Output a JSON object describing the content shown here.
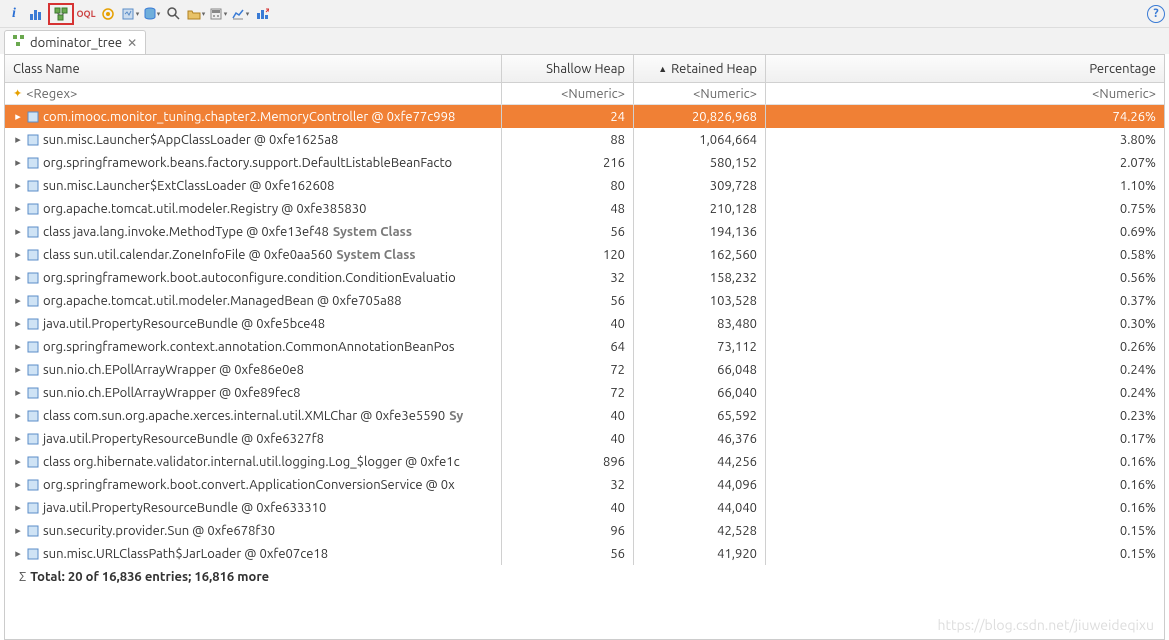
{
  "toolbar": {
    "help_tooltip": "Help"
  },
  "tab": {
    "label": "dominator_tree",
    "icon": "tree-icon"
  },
  "columns": {
    "name": "Class Name",
    "shallow": "Shallow Heap",
    "retained": "Retained Heap",
    "percent": "Percentage"
  },
  "filter": {
    "regex": "<Regex>",
    "numeric": "<Numeric>"
  },
  "rows": [
    {
      "name": "com.imooc.monitor_tuning.chapter2.MemoryController @ 0xfe77c998",
      "suffix": "",
      "shallow": "24",
      "retained": "20,826,968",
      "percent": "74.26%",
      "selected": true
    },
    {
      "name": "sun.misc.Launcher$AppClassLoader @ 0xfe1625a8",
      "suffix": "",
      "shallow": "88",
      "retained": "1,064,664",
      "percent": "3.80%"
    },
    {
      "name": "org.springframework.beans.factory.support.DefaultListableBeanFacto",
      "suffix": "",
      "shallow": "216",
      "retained": "580,152",
      "percent": "2.07%"
    },
    {
      "name": "sun.misc.Launcher$ExtClassLoader @ 0xfe162608",
      "suffix": "",
      "shallow": "80",
      "retained": "309,728",
      "percent": "1.10%"
    },
    {
      "name": "org.apache.tomcat.util.modeler.Registry @ 0xfe385830",
      "suffix": "",
      "shallow": "48",
      "retained": "210,128",
      "percent": "0.75%"
    },
    {
      "name": "class java.lang.invoke.MethodType @ 0xfe13ef48",
      "suffix": "System Class",
      "shallow": "56",
      "retained": "194,136",
      "percent": "0.69%"
    },
    {
      "name": "class sun.util.calendar.ZoneInfoFile @ 0xfe0aa560",
      "suffix": "System Class",
      "shallow": "120",
      "retained": "162,560",
      "percent": "0.58%"
    },
    {
      "name": "org.springframework.boot.autoconfigure.condition.ConditionEvaluatio",
      "suffix": "",
      "shallow": "32",
      "retained": "158,232",
      "percent": "0.56%"
    },
    {
      "name": "org.apache.tomcat.util.modeler.ManagedBean @ 0xfe705a88",
      "suffix": "",
      "shallow": "56",
      "retained": "103,528",
      "percent": "0.37%"
    },
    {
      "name": "java.util.PropertyResourceBundle @ 0xfe5bce48",
      "suffix": "",
      "shallow": "40",
      "retained": "83,480",
      "percent": "0.30%"
    },
    {
      "name": "org.springframework.context.annotation.CommonAnnotationBeanPos",
      "suffix": "",
      "shallow": "64",
      "retained": "73,112",
      "percent": "0.26%"
    },
    {
      "name": "sun.nio.ch.EPollArrayWrapper @ 0xfe86e0e8",
      "suffix": "",
      "shallow": "72",
      "retained": "66,048",
      "percent": "0.24%"
    },
    {
      "name": "sun.nio.ch.EPollArrayWrapper @ 0xfe89fec8",
      "suffix": "",
      "shallow": "72",
      "retained": "66,040",
      "percent": "0.24%"
    },
    {
      "name": "class com.sun.org.apache.xerces.internal.util.XMLChar @ 0xfe3e5590",
      "suffix": "Sy",
      "shallow": "40",
      "retained": "65,592",
      "percent": "0.23%"
    },
    {
      "name": "java.util.PropertyResourceBundle @ 0xfe6327f8",
      "suffix": "",
      "shallow": "40",
      "retained": "46,376",
      "percent": "0.17%"
    },
    {
      "name": "class org.hibernate.validator.internal.util.logging.Log_$logger @ 0xfe1c",
      "suffix": "",
      "shallow": "896",
      "retained": "44,256",
      "percent": "0.16%"
    },
    {
      "name": "org.springframework.boot.convert.ApplicationConversionService @ 0x",
      "suffix": "",
      "shallow": "32",
      "retained": "44,096",
      "percent": "0.16%"
    },
    {
      "name": "java.util.PropertyResourceBundle @ 0xfe633310",
      "suffix": "",
      "shallow": "40",
      "retained": "44,040",
      "percent": "0.16%"
    },
    {
      "name": "sun.security.provider.Sun @ 0xfe678f30",
      "suffix": "",
      "shallow": "96",
      "retained": "42,528",
      "percent": "0.15%"
    },
    {
      "name": "sun.misc.URLClassPath$JarLoader @ 0xfe07ce18",
      "suffix": "",
      "shallow": "56",
      "retained": "41,920",
      "percent": "0.15%"
    }
  ],
  "summary": "Total: 20 of 16,836 entries; 16,816 more",
  "watermark": "https://blog.csdn.net/jiuweideqixu"
}
